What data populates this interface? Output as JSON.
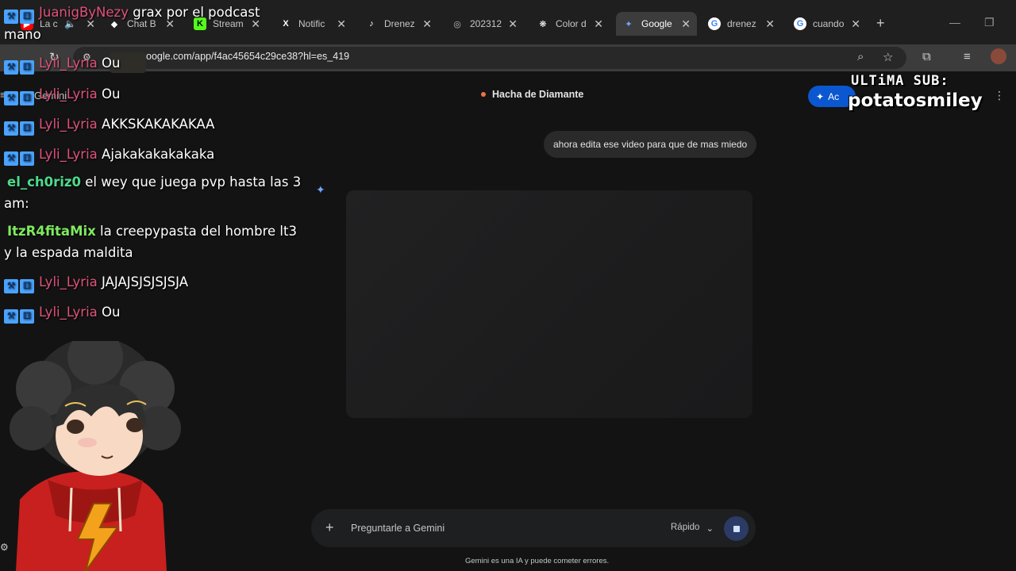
{
  "browser": {
    "tabs": [
      {
        "label": "La c",
        "favicon": "youtube-icon",
        "color": "#ff0000",
        "glyph": "▶"
      },
      {
        "label": "Chat B",
        "favicon": "chat-icon",
        "color": "#ffffff",
        "glyph": "◆"
      },
      {
        "label": "Stream",
        "favicon": "kick-icon",
        "color": "#53fc18",
        "glyph": "K"
      },
      {
        "label": "Notific",
        "favicon": "x-icon",
        "color": "#ffffff",
        "glyph": "X"
      },
      {
        "label": "Drenez",
        "favicon": "tiktok-icon",
        "color": "#ffffff",
        "glyph": "♪"
      },
      {
        "label": "202312",
        "favicon": "globe-icon",
        "color": "#bbbbbb",
        "glyph": "◎"
      },
      {
        "label": "Color d",
        "favicon": "openai-icon",
        "color": "#ffffff",
        "glyph": "❋"
      },
      {
        "label": "Google",
        "favicon": "gemini-icon",
        "color": "#6ea8ff",
        "glyph": "✦",
        "active": true
      },
      {
        "label": "drenez",
        "favicon": "google-icon",
        "color": "#ffffff",
        "glyph": "G"
      },
      {
        "label": "cuando",
        "favicon": "google-icon",
        "color": "#ffffff",
        "glyph": "G"
      }
    ],
    "url": "oogle.com/app/f4ac45654c29ce38?hl=es_419"
  },
  "gemini": {
    "app_name": "Gemini",
    "chat_title": "Hacha de Diamante",
    "upgrade_label": "Ac",
    "user_message": "ahora edita ese video para que de mas miedo",
    "prompt_placeholder": "Preguntarle a Gemini",
    "mode": "Rápido",
    "disclaimer": "Gemini es una IA y puede cometer errores."
  },
  "chat_messages": [
    {
      "user": "JuanigByNezy",
      "text": "grax por el podcast",
      "text2": "mano"
    },
    {
      "user": "Lyli_Lyria",
      "text": "Ou"
    },
    {
      "user": "Lyli_Lyria",
      "text": "AKKSKAKAKAKAA"
    },
    {
      "user": "Lyli_Lyria",
      "text": "Ajakakakakakaka"
    },
    {
      "user": "el_ch0riz0",
      "text": "el wey que juega pvp hasta las 3",
      "text2": "am:"
    },
    {
      "user": "ItzR4fitaMix",
      "text": "la creepypasta del hombre lt3",
      "text2": "y la espada maldita"
    },
    {
      "user": "Lyli_Lyria",
      "text": "JAJAJSJSJSJSJA"
    },
    {
      "user": "Lyli_Lyria",
      "text": "Ou"
    }
  ],
  "overlay": {
    "sub_label": "ULTiMA SUB:",
    "sub_name": "potatosmiley"
  }
}
